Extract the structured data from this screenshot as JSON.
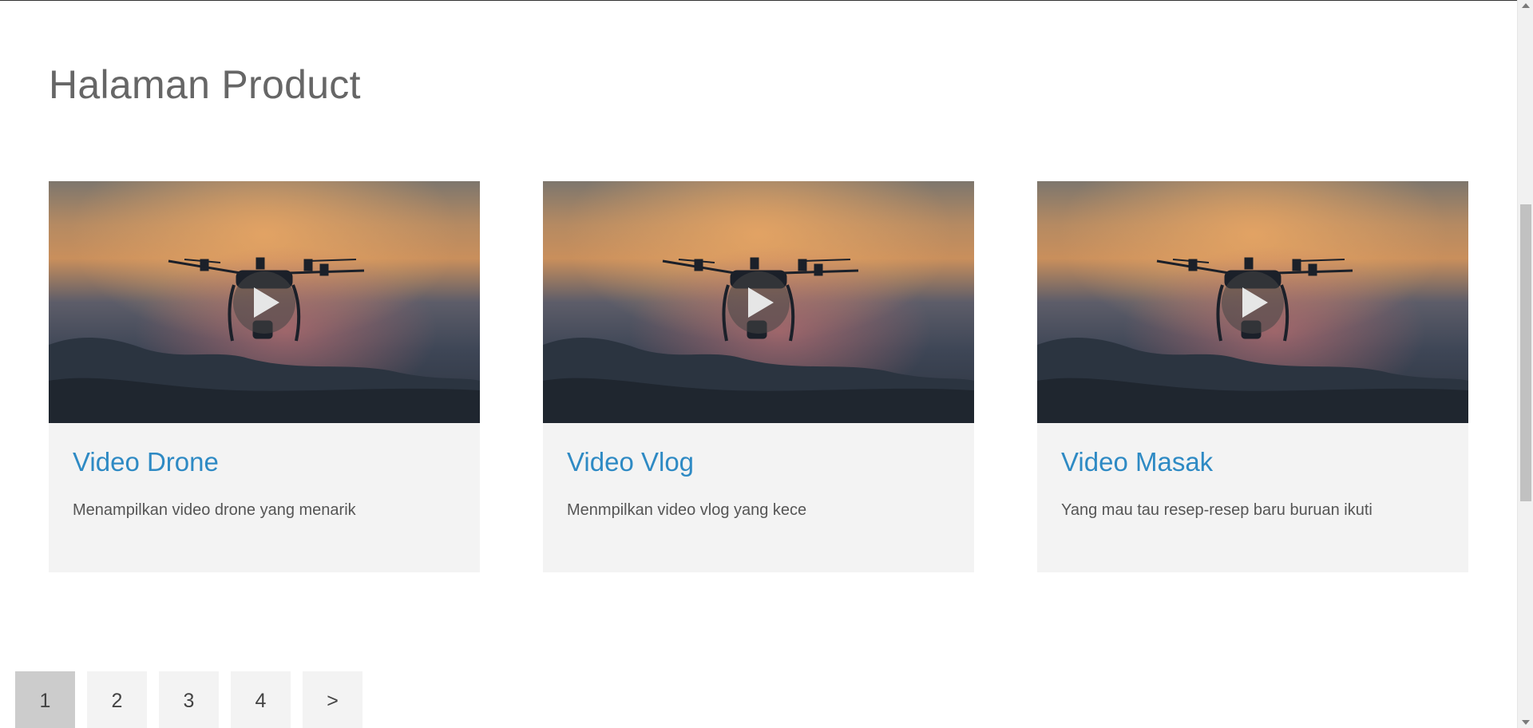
{
  "page": {
    "title": "Halaman Product"
  },
  "cards": [
    {
      "title": "Video Drone",
      "description": "Menampilkan video drone yang menarik",
      "thumbnail_icon": "play-icon"
    },
    {
      "title": "Video Vlog",
      "description": "Menmpilkan video vlog yang kece",
      "thumbnail_icon": "play-icon"
    },
    {
      "title": "Video Masak",
      "description": "Yang mau tau resep-resep baru buruan ikuti",
      "thumbnail_icon": "play-icon"
    }
  ],
  "pagination": {
    "pages": [
      "1",
      "2",
      "3",
      "4"
    ],
    "next_label": ">",
    "active_page": "1"
  },
  "colors": {
    "title_link": "#2e8ac4",
    "card_background": "#f3f3f3",
    "active_page_background": "#cccccc"
  }
}
